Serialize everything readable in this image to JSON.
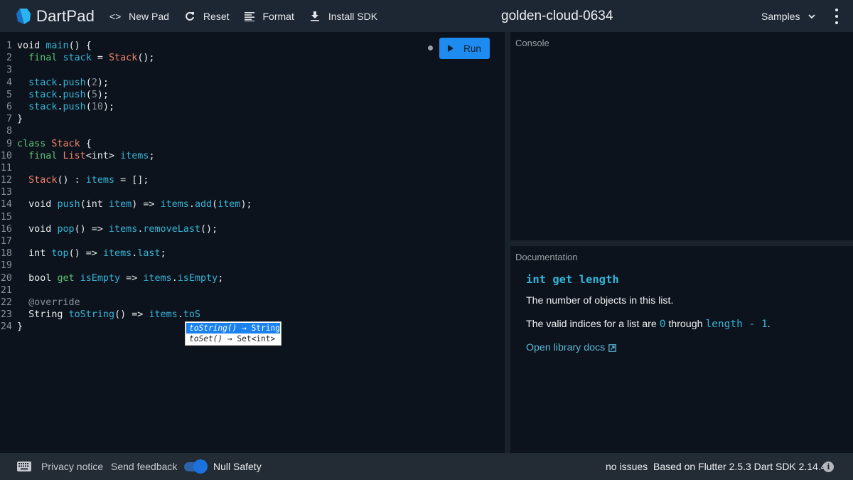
{
  "header": {
    "app_name": "DartPad",
    "new_pad_label": "New Pad",
    "reset_label": "Reset",
    "format_label": "Format",
    "install_sdk_label": "Install SDK",
    "pad_title": "golden-cloud-0634",
    "samples_label": "Samples",
    "new_pad_icon": "<>",
    "reset_icon": "↻"
  },
  "editor": {
    "run_label": "Run",
    "lines": [
      {
        "n": "1",
        "tokens": [
          [
            "kw",
            "void "
          ],
          [
            "id",
            "main"
          ],
          [
            "punc",
            "() {"
          ]
        ]
      },
      {
        "n": "2",
        "tokens": [
          [
            "punc",
            "  "
          ],
          [
            "kw2",
            "final "
          ],
          [
            "id",
            "stack"
          ],
          [
            "punc",
            " = "
          ],
          [
            "cls",
            "Stack"
          ],
          [
            "punc",
            "();"
          ]
        ]
      },
      {
        "n": "3",
        "tokens": []
      },
      {
        "n": "4",
        "tokens": [
          [
            "punc",
            "  "
          ],
          [
            "id",
            "stack"
          ],
          [
            "punc",
            "."
          ],
          [
            "id",
            "push"
          ],
          [
            "punc",
            "("
          ],
          [
            "num",
            "2"
          ],
          [
            "punc",
            ");"
          ]
        ]
      },
      {
        "n": "5",
        "tokens": [
          [
            "punc",
            "  "
          ],
          [
            "id",
            "stack"
          ],
          [
            "punc",
            "."
          ],
          [
            "id",
            "push"
          ],
          [
            "punc",
            "("
          ],
          [
            "num",
            "5"
          ],
          [
            "punc",
            ");"
          ]
        ]
      },
      {
        "n": "6",
        "tokens": [
          [
            "punc",
            "  "
          ],
          [
            "id",
            "stack"
          ],
          [
            "punc",
            "."
          ],
          [
            "id",
            "push"
          ],
          [
            "punc",
            "("
          ],
          [
            "num",
            "10"
          ],
          [
            "punc",
            ");"
          ]
        ]
      },
      {
        "n": "7",
        "tokens": [
          [
            "punc",
            "}"
          ]
        ]
      },
      {
        "n": "8",
        "tokens": []
      },
      {
        "n": "9",
        "tokens": [
          [
            "kw2",
            "class "
          ],
          [
            "cls",
            "Stack"
          ],
          [
            "punc",
            " {"
          ]
        ]
      },
      {
        "n": "10",
        "tokens": [
          [
            "punc",
            "  "
          ],
          [
            "kw2",
            "final "
          ],
          [
            "cls",
            "List"
          ],
          [
            "punc",
            "<int> "
          ],
          [
            "id",
            "items"
          ],
          [
            "punc",
            ";"
          ]
        ]
      },
      {
        "n": "11",
        "tokens": []
      },
      {
        "n": "12",
        "tokens": [
          [
            "punc",
            "  "
          ],
          [
            "cls",
            "Stack"
          ],
          [
            "punc",
            "() : "
          ],
          [
            "id",
            "items"
          ],
          [
            "punc",
            " = [];"
          ]
        ]
      },
      {
        "n": "13",
        "tokens": []
      },
      {
        "n": "14",
        "tokens": [
          [
            "punc",
            "  void "
          ],
          [
            "id",
            "push"
          ],
          [
            "punc",
            "(int "
          ],
          [
            "id",
            "item"
          ],
          [
            "punc",
            ") => "
          ],
          [
            "id",
            "items"
          ],
          [
            "punc",
            "."
          ],
          [
            "id",
            "add"
          ],
          [
            "punc",
            "("
          ],
          [
            "id",
            "item"
          ],
          [
            "punc",
            ");"
          ]
        ]
      },
      {
        "n": "15",
        "tokens": []
      },
      {
        "n": "16",
        "tokens": [
          [
            "punc",
            "  void "
          ],
          [
            "id",
            "pop"
          ],
          [
            "punc",
            "() => "
          ],
          [
            "id",
            "items"
          ],
          [
            "punc",
            "."
          ],
          [
            "id",
            "removeLast"
          ],
          [
            "punc",
            "();"
          ]
        ]
      },
      {
        "n": "17",
        "tokens": []
      },
      {
        "n": "18",
        "tokens": [
          [
            "punc",
            "  int "
          ],
          [
            "id",
            "top"
          ],
          [
            "punc",
            "() => "
          ],
          [
            "id",
            "items"
          ],
          [
            "punc",
            "."
          ],
          [
            "id",
            "last"
          ],
          [
            "punc",
            ";"
          ]
        ]
      },
      {
        "n": "19",
        "tokens": []
      },
      {
        "n": "20",
        "tokens": [
          [
            "punc",
            "  bool "
          ],
          [
            "kw2",
            "get "
          ],
          [
            "id",
            "isEmpty"
          ],
          [
            "punc",
            " => "
          ],
          [
            "id",
            "items"
          ],
          [
            "punc",
            "."
          ],
          [
            "id",
            "isEmpty"
          ],
          [
            "punc",
            ";"
          ]
        ]
      },
      {
        "n": "21",
        "tokens": []
      },
      {
        "n": "22",
        "tokens": [
          [
            "punc",
            "  "
          ],
          [
            "ann",
            "@override"
          ]
        ]
      },
      {
        "n": "23",
        "tokens": [
          [
            "punc",
            "  String "
          ],
          [
            "id",
            "toString"
          ],
          [
            "punc",
            "() => "
          ],
          [
            "id",
            "items"
          ],
          [
            "punc",
            "."
          ],
          [
            "id",
            "toS"
          ]
        ]
      },
      {
        "n": "24",
        "tokens": [
          [
            "punc",
            "}"
          ]
        ]
      }
    ],
    "autocomplete": [
      {
        "name": "toString()",
        "type": " → String",
        "selected": true
      },
      {
        "name": "toSet()",
        "type": " → Set<int>",
        "selected": false
      }
    ]
  },
  "console": {
    "label": "Console"
  },
  "documentation": {
    "label": "Documentation",
    "signature": "int get length",
    "p1": "The number of objects in this list.",
    "p2_before": "The valid indices for a list are ",
    "p2_code1": "0",
    "p2_mid": " through ",
    "p2_code2": "length - 1",
    "p2_after": ".",
    "link_label": "Open library docs"
  },
  "footer": {
    "privacy_label": "Privacy notice",
    "feedback_label": "Send feedback",
    "null_safety_label": "Null Safety",
    "null_safety_enabled": true,
    "issues_label": "no issues",
    "version_label": "Based on Flutter 2.5.3 Dart SDK 2.14.4",
    "info_icon": "i"
  },
  "colors": {
    "accent": "#1d8bf0",
    "header_bg": "#1d2733",
    "editor_bg": "#0d131c",
    "identifier": "#35b5d8",
    "class_name": "#f0826a",
    "keyword": "#5cc276"
  }
}
